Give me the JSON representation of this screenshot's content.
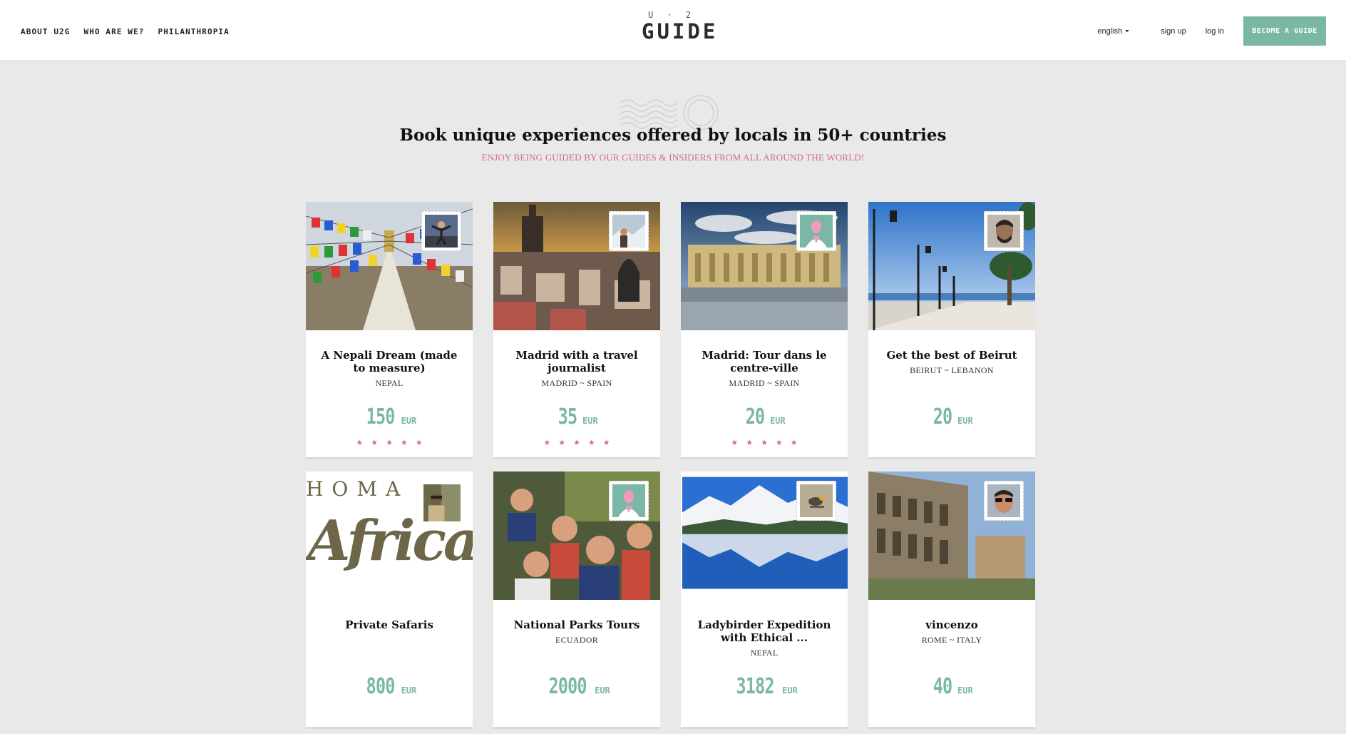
{
  "header": {
    "nav": [
      "ABOUT U2G",
      "WHO ARE WE?",
      "PHILANTHROPIA"
    ],
    "logo_top": "U · 2",
    "logo_main": "GUIDE",
    "language": "english",
    "signup": "sign up",
    "login": "log in",
    "become_guide": "BECOME A GUIDE",
    "accent_color": "#7ab7a5"
  },
  "hero": {
    "title": "Book unique experiences offered by locals in 50+ countries",
    "subtitle": "ENJOY BEING GUIDED BY OUR GUIDES & INSIDERS FROM ALL AROUND THE WORLD!",
    "subtitle_color": "#d4679b"
  },
  "tours": [
    {
      "title": "A Nepali Dream (made to measure)",
      "location": "NEPAL",
      "price": "150",
      "currency": "EUR",
      "rating": 5
    },
    {
      "title": "Madrid with a travel journalist",
      "location": "MADRID ~ SPAIN",
      "price": "35",
      "currency": "EUR",
      "rating": 5
    },
    {
      "title": "Madrid: Tour dans le centre-ville",
      "location": "MADRID ~ SPAIN",
      "price": "20",
      "currency": "EUR",
      "rating": 5
    },
    {
      "title": "Get the best of Beirut",
      "location": "BEIRUT ~ LEBANON",
      "price": "20",
      "currency": "EUR",
      "rating": 0
    },
    {
      "title": "Private Safaris",
      "location": "",
      "price": "800",
      "currency": "EUR",
      "rating": 0,
      "image_text": "HOMA Africa"
    },
    {
      "title": "National Parks Tours",
      "location": "ECUADOR",
      "price": "2000",
      "currency": "EUR",
      "rating": 0
    },
    {
      "title": "Ladybirder Expedition with Ethical ...",
      "location": "NEPAL",
      "price": "3182",
      "currency": "EUR",
      "rating": 0
    },
    {
      "title": "vincenzo",
      "location": "ROME ~ ITALY",
      "price": "40",
      "currency": "EUR",
      "rating": 0
    }
  ],
  "rating_star": "★★★★★"
}
